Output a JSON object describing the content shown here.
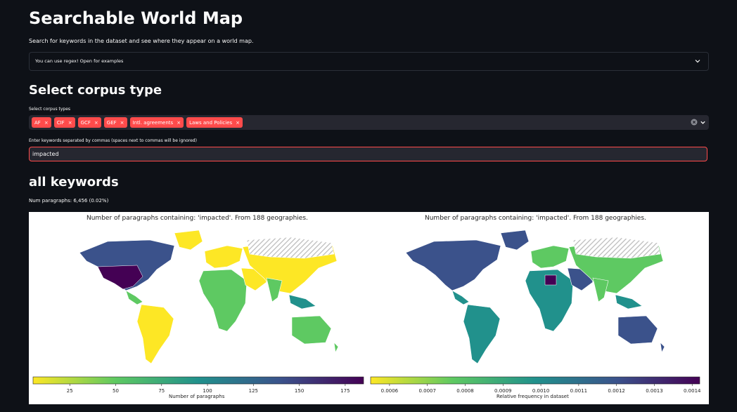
{
  "page": {
    "title": "Searchable World Map",
    "subtitle": "Search for keywords in the dataset and see where they appear on a world map.",
    "expander_label": "You can use regex! Open for examples"
  },
  "corpus": {
    "heading": "Select corpus type",
    "label": "Select corpus types",
    "tags": [
      "AF",
      "CIF",
      "GCF",
      "GEF",
      "Intl. agreements",
      "Laws and Policies"
    ]
  },
  "keywords": {
    "label": "Enter keywords separated by commas (spaces next to commas will be ignored)",
    "value": "impacted"
  },
  "results": {
    "heading": "all keywords",
    "stat": "Num paragraphs: 6,456 (0.02%)"
  },
  "maps": [
    {
      "title": "Number of paragraphs containing: 'impacted'. From 188 geographies.",
      "colorbar_label": "Number of paragraphs",
      "ticks": [
        "25",
        "50",
        "75",
        "100",
        "125",
        "150",
        "175"
      ],
      "tick_values": [
        25,
        50,
        75,
        100,
        125,
        150,
        175
      ],
      "range": [
        5,
        185
      ],
      "reversed_colormap": true
    },
    {
      "title": "Number of paragraphs containing: 'impacted'. From 188 geographies.",
      "colorbar_label": "Relative frequency in dataset",
      "ticks": [
        "0.0006",
        "0.0007",
        "0.0008",
        "0.0009",
        "0.0010",
        "0.0011",
        "0.0012",
        "0.0013",
        "0.0014"
      ],
      "tick_values": [
        0.0006,
        0.0007,
        0.0008,
        0.0009,
        0.001,
        0.0011,
        0.0012,
        0.0013,
        0.0014
      ],
      "range": [
        0.00055,
        0.00142
      ],
      "reversed_colormap": true
    }
  ],
  "colors": {
    "accent": "#ff4b4b",
    "background": "#0e1117",
    "widget": "#262730",
    "viridis": [
      "#440154",
      "#3b528b",
      "#21918c",
      "#5ec962",
      "#fde725"
    ],
    "no_data_hatch": "#bbbbbb"
  }
}
